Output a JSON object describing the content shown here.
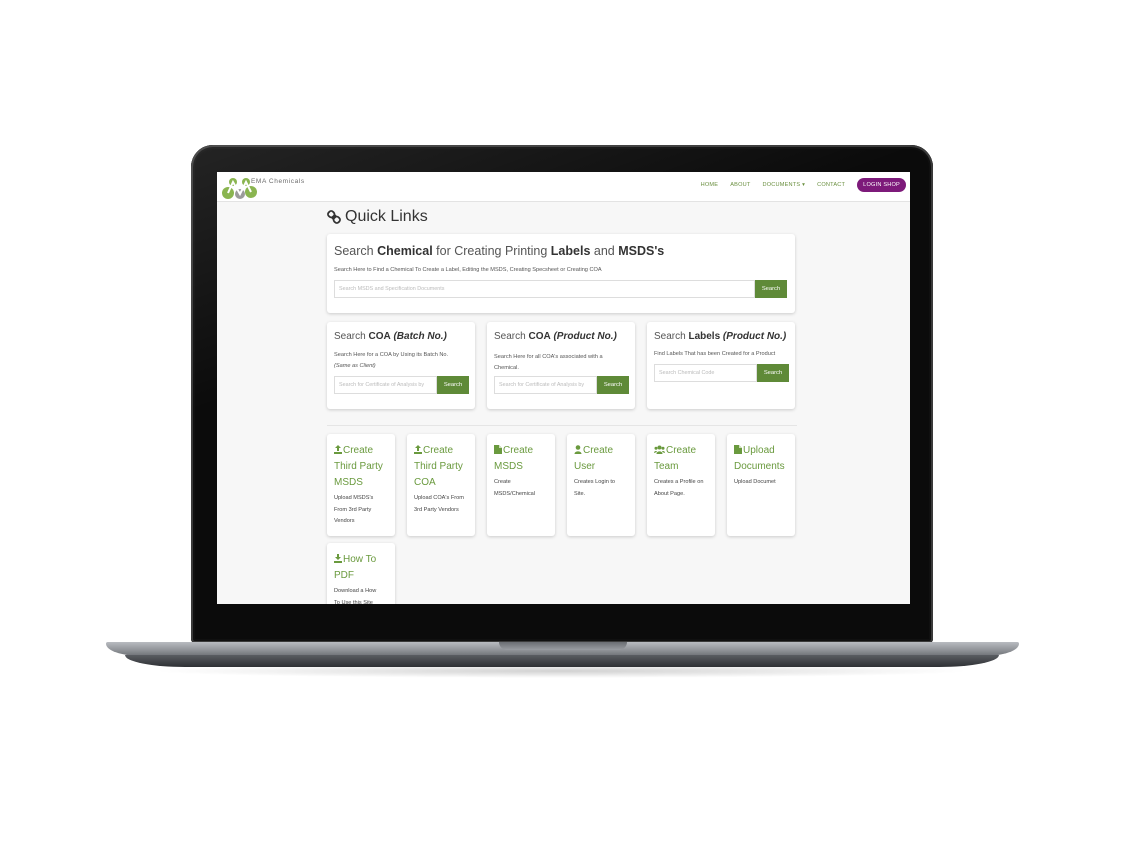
{
  "app": {
    "brand": "EMA Chemicals"
  },
  "nav": {
    "items": [
      "HOME",
      "ABOUT",
      "DOCUMENTS",
      "CONTACT"
    ],
    "login": "LOGIN SHOP"
  },
  "page": {
    "title": "Quick Links"
  },
  "search_chemical": {
    "title_parts": [
      "Search ",
      "Chemical",
      " for Creating Printing ",
      "Labels",
      " and ",
      "MSDS's"
    ],
    "desc": "Search Here to Find a Chemical To Create a Label, Editing the MSDS, Creating Specsheet or Creating COA",
    "placeholder": "Search MSDS and Specification Documents",
    "button": "Search"
  },
  "search_coa_batch": {
    "title_a": "Search ",
    "title_b": "COA",
    "title_c": " (Batch No.)",
    "desc": "Search Here for a COA by Using its Batch No.",
    "note": "(Same as Client)",
    "placeholder": "Search for Certificate of Analysis by",
    "button": "Search"
  },
  "search_coa_product": {
    "title_a": "Search ",
    "title_b": "COA",
    "title_c": " (Product No.)",
    "desc": "Search Here for all COA's associated with a Chemical.",
    "placeholder": "Search for Certificate of Analysis by",
    "button": "Search"
  },
  "search_labels": {
    "title_a": "Search ",
    "title_b": "Labels",
    "title_c": " (Product No.)",
    "desc": "Find Labels That has been Created for a Product",
    "placeholder": "Search Chemical Code",
    "button": "Search"
  },
  "tiles": [
    {
      "icon": "upload-icon",
      "l1": "Create",
      "l2": "Third Party",
      "l3": "MSDS",
      "d1": "Upload MSDS's",
      "d2": "From 3rd Party",
      "d3": "Vendors"
    },
    {
      "icon": "upload-icon",
      "l1": "Create",
      "l2": "Third Party",
      "l3": "COA",
      "d1": "Upload COA's From",
      "d2": "3rd Party Vendors",
      "d3": ""
    },
    {
      "icon": "file-icon",
      "l1": "Create",
      "l2": "MSDS",
      "l3": "",
      "d1": "Create",
      "d2": "MSDS/Chemical",
      "d3": ""
    },
    {
      "icon": "user-icon",
      "l1": "Create",
      "l2": "User",
      "l3": "",
      "d1": "Creates Login to",
      "d2": "Site.",
      "d3": ""
    },
    {
      "icon": "users-icon",
      "l1": "Create",
      "l2": "Team",
      "l3": "",
      "d1": "Creates a Profile on",
      "d2": "About Page.",
      "d3": ""
    },
    {
      "icon": "file-icon",
      "l1": "Upload",
      "l2": "Documents",
      "l3": "",
      "d1": "Upload Documet",
      "d2": "",
      "d3": ""
    },
    {
      "icon": "download-icon",
      "l1": "How To",
      "l2": "PDF",
      "l3": "",
      "d1": "Download a How",
      "d2": "To Use this Site",
      "d3": ""
    }
  ],
  "colors": {
    "accent": "#5f8a38",
    "nav_link": "#6a8f3f",
    "login": "#7d1a7a",
    "tile_title": "#6a9a3e"
  }
}
